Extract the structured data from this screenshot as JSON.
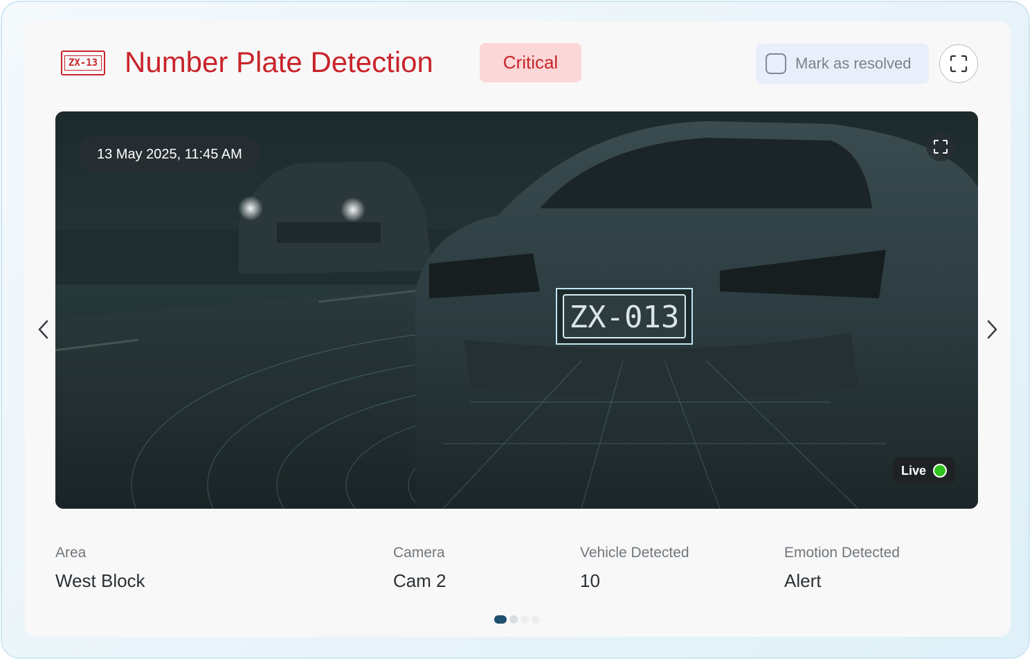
{
  "header": {
    "icon_text": "ZX-13",
    "title": "Number Plate Detection",
    "severity": "Critical",
    "resolve_label": "Mark as resolved",
    "resolved": false
  },
  "viewer": {
    "timestamp": "13 May 2025, 11:45 AM",
    "plate_text": "ZX-013",
    "live_label": "Live",
    "live_color": "#2fc11c"
  },
  "details": [
    {
      "label": "Area",
      "value": "West Block"
    },
    {
      "label": "Camera",
      "value": "Cam 2"
    },
    {
      "label": "Vehicle Detected",
      "value": "10"
    },
    {
      "label": "Emotion Detected",
      "value": "Alert"
    }
  ],
  "pagination": {
    "total": 4,
    "active": 1
  },
  "colors": {
    "accent": "#c8242a",
    "badge_bg": "#fcd7d7",
    "pagination_active": "#1e4f6e"
  }
}
